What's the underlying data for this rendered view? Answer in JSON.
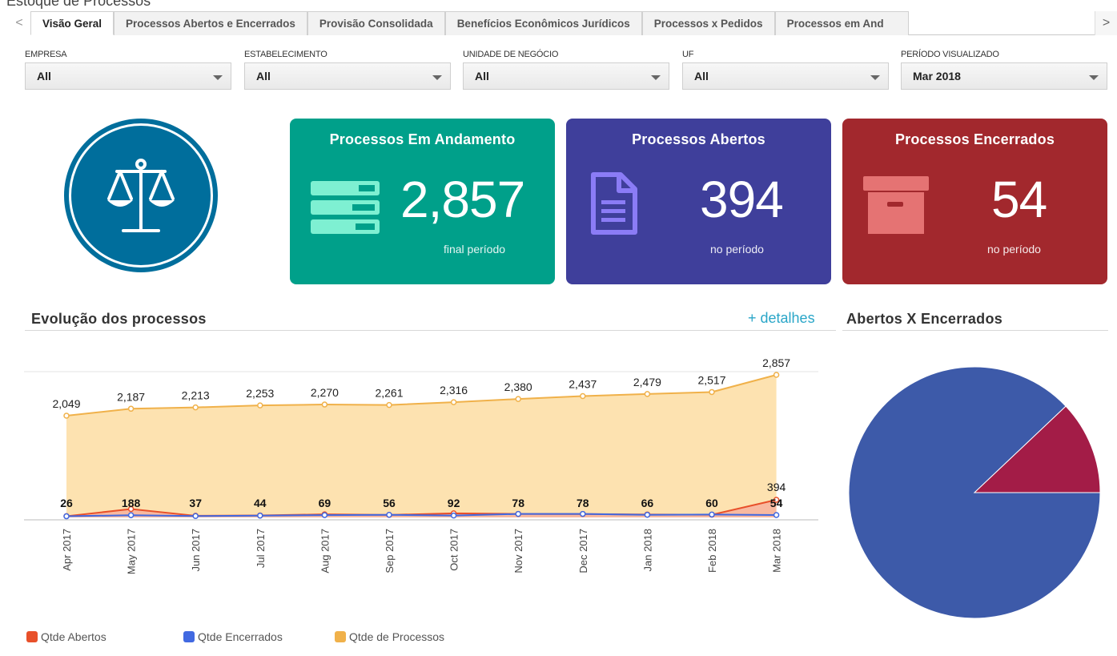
{
  "page": {
    "title_cut": "Estoque de Processos"
  },
  "tabs": [
    {
      "label": "Visão Geral",
      "active": true
    },
    {
      "label": "Processos Abertos e Encerrados"
    },
    {
      "label": "Provisão Consolidada"
    },
    {
      "label": "Benefícios Econômicos Jurídicos"
    },
    {
      "label": "Processos x Pedidos"
    },
    {
      "label": "Processos em And"
    }
  ],
  "tab_nav": {
    "prev": "<",
    "next": ">"
  },
  "filters": [
    {
      "label": "EMPRESA",
      "value": "All"
    },
    {
      "label": "ESTABELECIMENTO",
      "value": "All"
    },
    {
      "label": "UNIDADE DE NEGÓCIO",
      "value": "All"
    },
    {
      "label": "UF",
      "value": "All"
    },
    {
      "label": "PERÍODO VISUALIZADO",
      "value": "Mar 2018"
    }
  ],
  "logo": {
    "icon": "scales-of-justice-icon"
  },
  "kpis": {
    "andamento": {
      "title": "Processos Em Andamento",
      "value": "2,857",
      "sub": "final período",
      "color": "#00a08a",
      "icon": "server-stack-icon"
    },
    "abertos": {
      "title": "Processos Abertos",
      "value": "394",
      "sub": "no período",
      "color": "#3f3f9b",
      "icon": "document-icon"
    },
    "encerrados": {
      "title": "Processos Encerrados",
      "value": "54",
      "sub": "no período",
      "color": "#a2282d",
      "icon": "archive-box-icon"
    }
  },
  "sections": {
    "evolucao": {
      "title": "Evolução dos processos",
      "link": "+ detalhes"
    },
    "pie": {
      "title": "Abertos X Encerrados"
    }
  },
  "colors": {
    "abertos": "#e8502a",
    "encerrados": "#4169e1",
    "processos": "#f0b14a",
    "pie_encerrados": "#a31c47",
    "pie_abertos": "#3d5aa9"
  },
  "chart_data": [
    {
      "type": "area",
      "categories": [
        "Apr 2017",
        "May 2017",
        "Jun 2017",
        "Jul 2017",
        "Aug 2017",
        "Sep 2017",
        "Oct 2017",
        "Nov 2017",
        "Dec 2017",
        "Jan 2018",
        "Feb 2018",
        "Mar 2018"
      ],
      "series": [
        {
          "name": "Qtde de Processos",
          "values": [
            2049,
            2187,
            2213,
            2253,
            2270,
            2261,
            2316,
            2380,
            2437,
            2479,
            2517,
            2857
          ]
        },
        {
          "name": "Qtde Abertos",
          "values": [
            28,
            188,
            37,
            44,
            69,
            56,
            92,
            79,
            76,
            66,
            60,
            394
          ]
        },
        {
          "name": "Qtde Encerrados",
          "values": [
            26,
            50,
            31,
            41,
            52,
            58,
            42,
            78,
            79,
            59,
            66,
            54
          ]
        }
      ],
      "overlap_labels": [
        "26",
        "188",
        "37",
        "44",
        "69",
        "56",
        "92",
        "78",
        "78",
        "66",
        "60",
        "54"
      ],
      "legend": "bottom-left",
      "grid": false
    },
    {
      "type": "pie",
      "categories": [
        "Qtde Abertos",
        "Qtde Encerrados"
      ],
      "values": [
        394,
        54
      ]
    }
  ],
  "legend": [
    {
      "label": "Qtde Abertos",
      "color": "#e8502a"
    },
    {
      "label": "Qtde Encerrados",
      "color": "#4169e1"
    },
    {
      "label": "Qtde de Processos",
      "color": "#f0b14a"
    }
  ]
}
